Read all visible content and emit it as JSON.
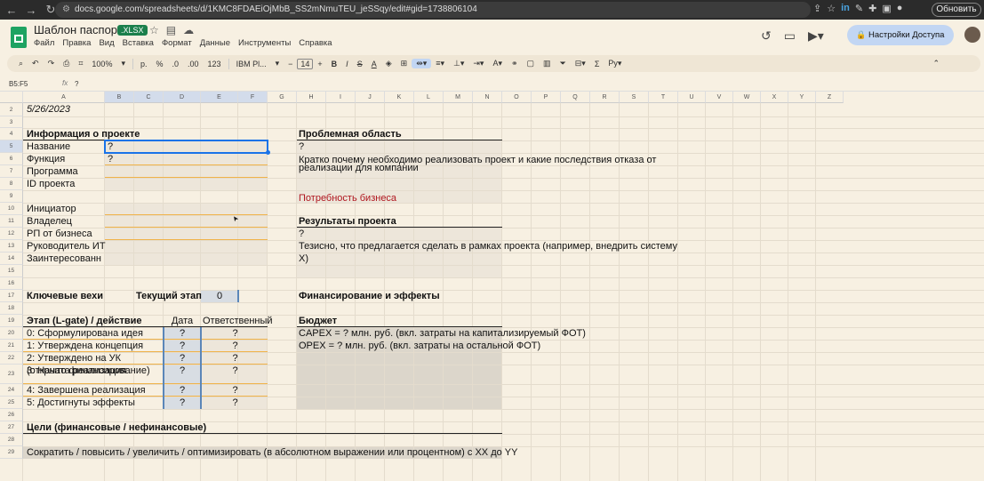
{
  "browser": {
    "url": "docs.google.com/spreadsheets/d/1KMC8FDAEiOjMbB_SS2mNmuTEU_jeSSqy/edit#gid=1738806104",
    "update_label": "Обновить"
  },
  "header": {
    "title": "Шаблон паспорта",
    "badge": ".XLSX",
    "menu": [
      "Файл",
      "Правка",
      "Вид",
      "Вставка",
      "Формат",
      "Данные",
      "Инструменты",
      "Справка"
    ],
    "share_label": "Настройки Доступа"
  },
  "toolbar": {
    "zoom": "100%",
    "currency": "р.",
    "percent": "%",
    "dec_decrease": ".0",
    "dec_increase": ".00",
    "num_format": "123",
    "font": "IBM Pl...",
    "font_size": "14"
  },
  "formula_bar": {
    "name_box": "B5:F5",
    "fx": "fx",
    "value": "?"
  },
  "columns": [
    "A",
    "B",
    "C",
    "D",
    "E",
    "F",
    "G",
    "H",
    "I",
    "J",
    "K",
    "L",
    "M",
    "N",
    "O",
    "P",
    "Q",
    "R",
    "S",
    "T",
    "U",
    "V",
    "W",
    "X",
    "Y",
    "Z"
  ],
  "rows": [
    "2",
    "3",
    "4",
    "5",
    "6",
    "7",
    "8",
    "9",
    "10",
    "11",
    "12",
    "13",
    "14",
    "15",
    "16",
    "17",
    "18",
    "19",
    "20",
    "21",
    "22",
    "23",
    "24",
    "25",
    "26",
    "27",
    "28",
    "29"
  ],
  "cells": {
    "date": "5/26/2023",
    "project_info_header": "Информация о проекте",
    "name_label": "Название",
    "name_value": "?",
    "function_label": "Функция",
    "function_value": "?",
    "program_label": "Программа",
    "project_id_label": "ID проекта",
    "initiator_label": "Инициатор",
    "owner_label": "Владелец",
    "rp_business_label": "РП от бизнеса",
    "it_lead_label": "Руководитель ИТ",
    "stakeholders_label": "Заинтересованн",
    "milestones_label": "Ключевые вехи",
    "current_stage_label": "Текущий этап",
    "current_stage_value": "0",
    "stage_header": "Этап (L-gate) / действие",
    "date_header": "Дата",
    "responsible_header": "Ответственный",
    "stages": [
      {
        "name": "0: Сформулирована идея",
        "date": "?",
        "resp": "?"
      },
      {
        "name": "1: Утверждена концепция",
        "date": "?",
        "resp": "?"
      },
      {
        "name": "2: Утверждено на УК",
        "name2": "(открыто финансирование)",
        "date": "?",
        "resp": "?"
      },
      {
        "name": "3: Начата реализация",
        "date": "?",
        "resp": "?"
      },
      {
        "name": "4: Завершена реализация",
        "date": "?",
        "resp": "?"
      },
      {
        "name": "5: Достигнуты эффекты",
        "date": "?",
        "resp": "?"
      }
    ],
    "goals_header": "Цели (финансовые / нефинансовые)",
    "goals_text": "Сократить / повысить / увеличить / оптимизировать (в абсолютном выражении или процентном) с ХХ до YY",
    "problem_header": "Проблемная область",
    "problem_q": "?",
    "problem_text1": "Кратко почему необходимо реализовать проект и какие последствия отказа от",
    "problem_text2": "реализации для компании",
    "business_need": "Потребность бизнеса",
    "results_header": "Результаты проекта",
    "results_q": "?",
    "results_text1": "Тезисно, что предлагается сделать в рамках проекта (например, внедрить систему",
    "results_text2": "Х)",
    "finance_header": "Финансирование и эффекты",
    "budget_header": "Бюджет",
    "capex": "CAPEX = ? млн. руб. (вкл. затраты на капитализируемый ФОТ)",
    "opex": "OPEX = ? млн. руб. (вкл. затраты на остальной ФОТ)"
  }
}
